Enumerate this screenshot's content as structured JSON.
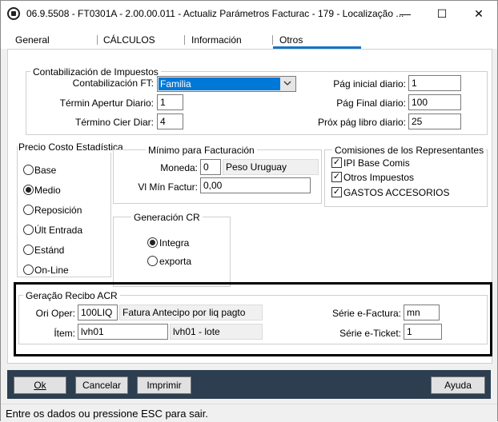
{
  "window": {
    "title": "06.9.5508 - FT0301A - 2.00.00.011 - Actualiz Parámetros Facturac - 179 - Localização ...",
    "minimize": "—",
    "maximize": "☐",
    "close": "✕"
  },
  "tabs": [
    {
      "label": "General"
    },
    {
      "label": "CÁLCULOS"
    },
    {
      "label": "Información"
    },
    {
      "label": "Otros",
      "active": true
    }
  ],
  "contab": {
    "title": "Contabilización de Impuestos",
    "ft_label": "Contabilización FT:",
    "ft_value": "Familia",
    "termin_apertur_label": "Términ Apertur Diario:",
    "termin_apertur_value": "1",
    "termino_cier_label": "Término Cier Diar:",
    "termino_cier_value": "4",
    "pag_inicial_label": "Pág inicial diario:",
    "pag_inicial_value": "1",
    "pag_final_label": "Pág Final diario:",
    "pag_final_value": "100",
    "prox_pag_label": "Próx pág libro diario:",
    "prox_pag_value": "25"
  },
  "precio": {
    "title": "Precio Costo Estadística",
    "options": [
      {
        "label": "Base",
        "selected": false
      },
      {
        "label": "Medio",
        "selected": true
      },
      {
        "label": "Reposición",
        "selected": false
      },
      {
        "label": "Últ Entrada",
        "selected": false
      },
      {
        "label": "Estánd",
        "selected": false
      },
      {
        "label": "On-Line",
        "selected": false
      }
    ]
  },
  "minimo": {
    "title": "Mínimo para Facturación",
    "moneda_label": "Moneda:",
    "moneda_value": "0",
    "moneda_desc": "Peso Uruguay",
    "vl_min_label": "Vl Mín Factur:",
    "vl_min_value": "0,00"
  },
  "comisiones": {
    "title": "Comisiones de los Representantes",
    "items": [
      {
        "label": "IPI Base Comis",
        "checked": true
      },
      {
        "label": "Otros Impuestos",
        "checked": true
      },
      {
        "label": "GASTOS ACCESORIOS",
        "checked": true
      }
    ]
  },
  "generacion": {
    "title": "Generación CR",
    "options": [
      {
        "label": "Integra",
        "selected": true
      },
      {
        "label": "exporta",
        "selected": false
      }
    ]
  },
  "acr": {
    "title": "Geração Recibo ACR",
    "ori_oper_label": "Ori Oper:",
    "ori_oper_value": "100LIQ",
    "ori_oper_desc": "Fatura Antecipo por liq pagto",
    "item_label": "Ítem:",
    "item_value": "lvh01",
    "item_desc": "lvh01 - lote",
    "serie_factura_label": "Série e-Factura:",
    "serie_factura_value": "mn",
    "serie_ticket_label": "Série e-Ticket:",
    "serie_ticket_value": "1"
  },
  "buttons": {
    "ok": "Ok",
    "cancel": "Cancelar",
    "print": "Imprimir",
    "help": "Ayuda"
  },
  "status": {
    "text": "Entre os dados ou pressione ESC para sair."
  },
  "colors": {
    "accent": "#1a73c6",
    "button_bar": "#2c3e50"
  }
}
